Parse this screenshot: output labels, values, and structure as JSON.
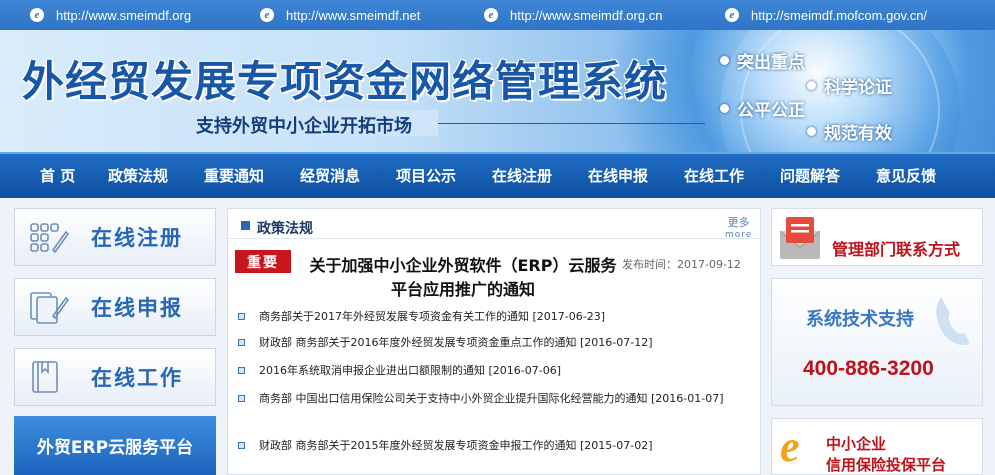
{
  "top_links": [
    {
      "icon": "e-icon",
      "url": "http://www.smeimdf.org"
    },
    {
      "icon": "e-icon",
      "url": "http://www.smeimdf.net"
    },
    {
      "icon": "e-icon",
      "url": "http://www.smeimdf.org.cn"
    },
    {
      "icon": "e-icon",
      "url": "http://smeimdf.mofcom.gov.cn/"
    }
  ],
  "banner": {
    "title": "外经贸发展专项资金网络管理系统",
    "subtitle": "支持外贸中小企业开拓市场",
    "tags": [
      "突出重点",
      "科学论证",
      "公平公正",
      "规范有效"
    ]
  },
  "nav": {
    "items": [
      "首 页",
      "政策法规",
      "重要通知",
      "经贸消息",
      "项目公示",
      "在线注册",
      "在线申报",
      "在线工作",
      "问题解答",
      "意见反馈"
    ]
  },
  "left": {
    "buttons": [
      "在线注册",
      "在线申报",
      "在线工作"
    ],
    "erp_label": "外贸ERP云服务平台"
  },
  "policy": {
    "title": "政策法规",
    "more_cn": "更多",
    "more_en": "more",
    "badge": "重要",
    "headline": "关于加强中小企业外贸软件（ERP）云服务平台应用推广的通知",
    "publish_time": "发布时间：2017-09-12",
    "news": [
      "商务部关于2017年外经贸发展专项资金有关工作的通知 [2017-06-23]",
      "财政部 商务部关于2016年度外经贸发展专项资金重点工作的通知 [2016-07-12]",
      "2016年系统取消申报企业进出口额限制的通知 [2016-07-06]",
      "商务部 中国出口信用保险公司关于支持中小外贸企业提升国际化经营能力的通知 [2016-01-07]",
      "财政部 商务部关于2015年度外经贸发展专项资金申报工作的通知 [2015-07-02]"
    ]
  },
  "right": {
    "contact_label": "管理部门联系方式",
    "support_label": "系统技术支持",
    "support_phone": "400-886-3200",
    "credit_line1": "中小企业",
    "credit_line2": "信用保险投保平台"
  },
  "colors": {
    "primary_blue": "#1f6cc4",
    "accent_red": "#c0121b",
    "badge_red": "#c7161d"
  }
}
